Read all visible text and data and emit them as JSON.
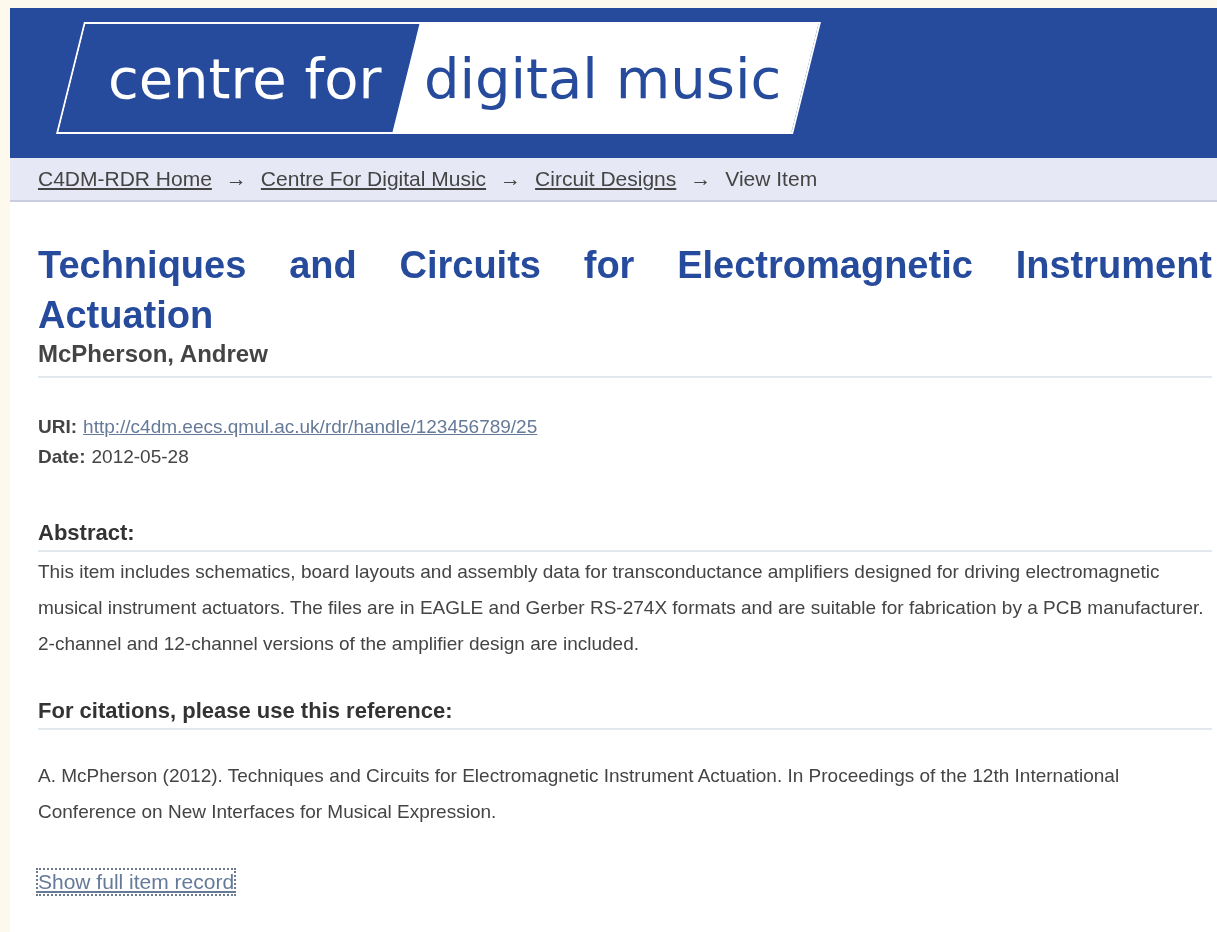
{
  "header": {
    "logo": {
      "left_text": "centre for",
      "right_text": "digital music"
    }
  },
  "breadcrumb": {
    "links": [
      "C4DM-RDR Home",
      "Centre For Digital Music",
      "Circuit Designs"
    ],
    "separator": "→",
    "current": "View Item"
  },
  "item": {
    "title": "Techniques and Circuits for Electromagnetic Instrument Actuation",
    "author": "McPherson, Andrew",
    "fields": [
      {
        "label": "URI:",
        "value": "http://c4dm.eecs.qmul.ac.uk/rdr/handle/123456789/25",
        "kind": "link"
      },
      {
        "label": "Date:",
        "value": "2012-05-28",
        "kind": "text"
      }
    ],
    "abstract": {
      "heading": "Abstract:",
      "text": "This item includes schematics, board layouts and assembly data for transconductance amplifiers designed for driving electromagnetic musical instrument actuators. The files are in EAGLE and Gerber RS-274X formats and are suitable for fabrication by a PCB manufacturer. 2-channel and 12-channel versions of the amplifier design are included."
    },
    "citation": {
      "heading": "For citations, please use this reference:",
      "text": "A. McPherson (2012). Techniques and Circuits for Electromagnetic Instrument Actuation. In Proceedings of the 12th International Conference on New Interfaces for Musical Expression."
    },
    "full_record_link": {
      "label": "Show full item record",
      "focused": true
    }
  }
}
